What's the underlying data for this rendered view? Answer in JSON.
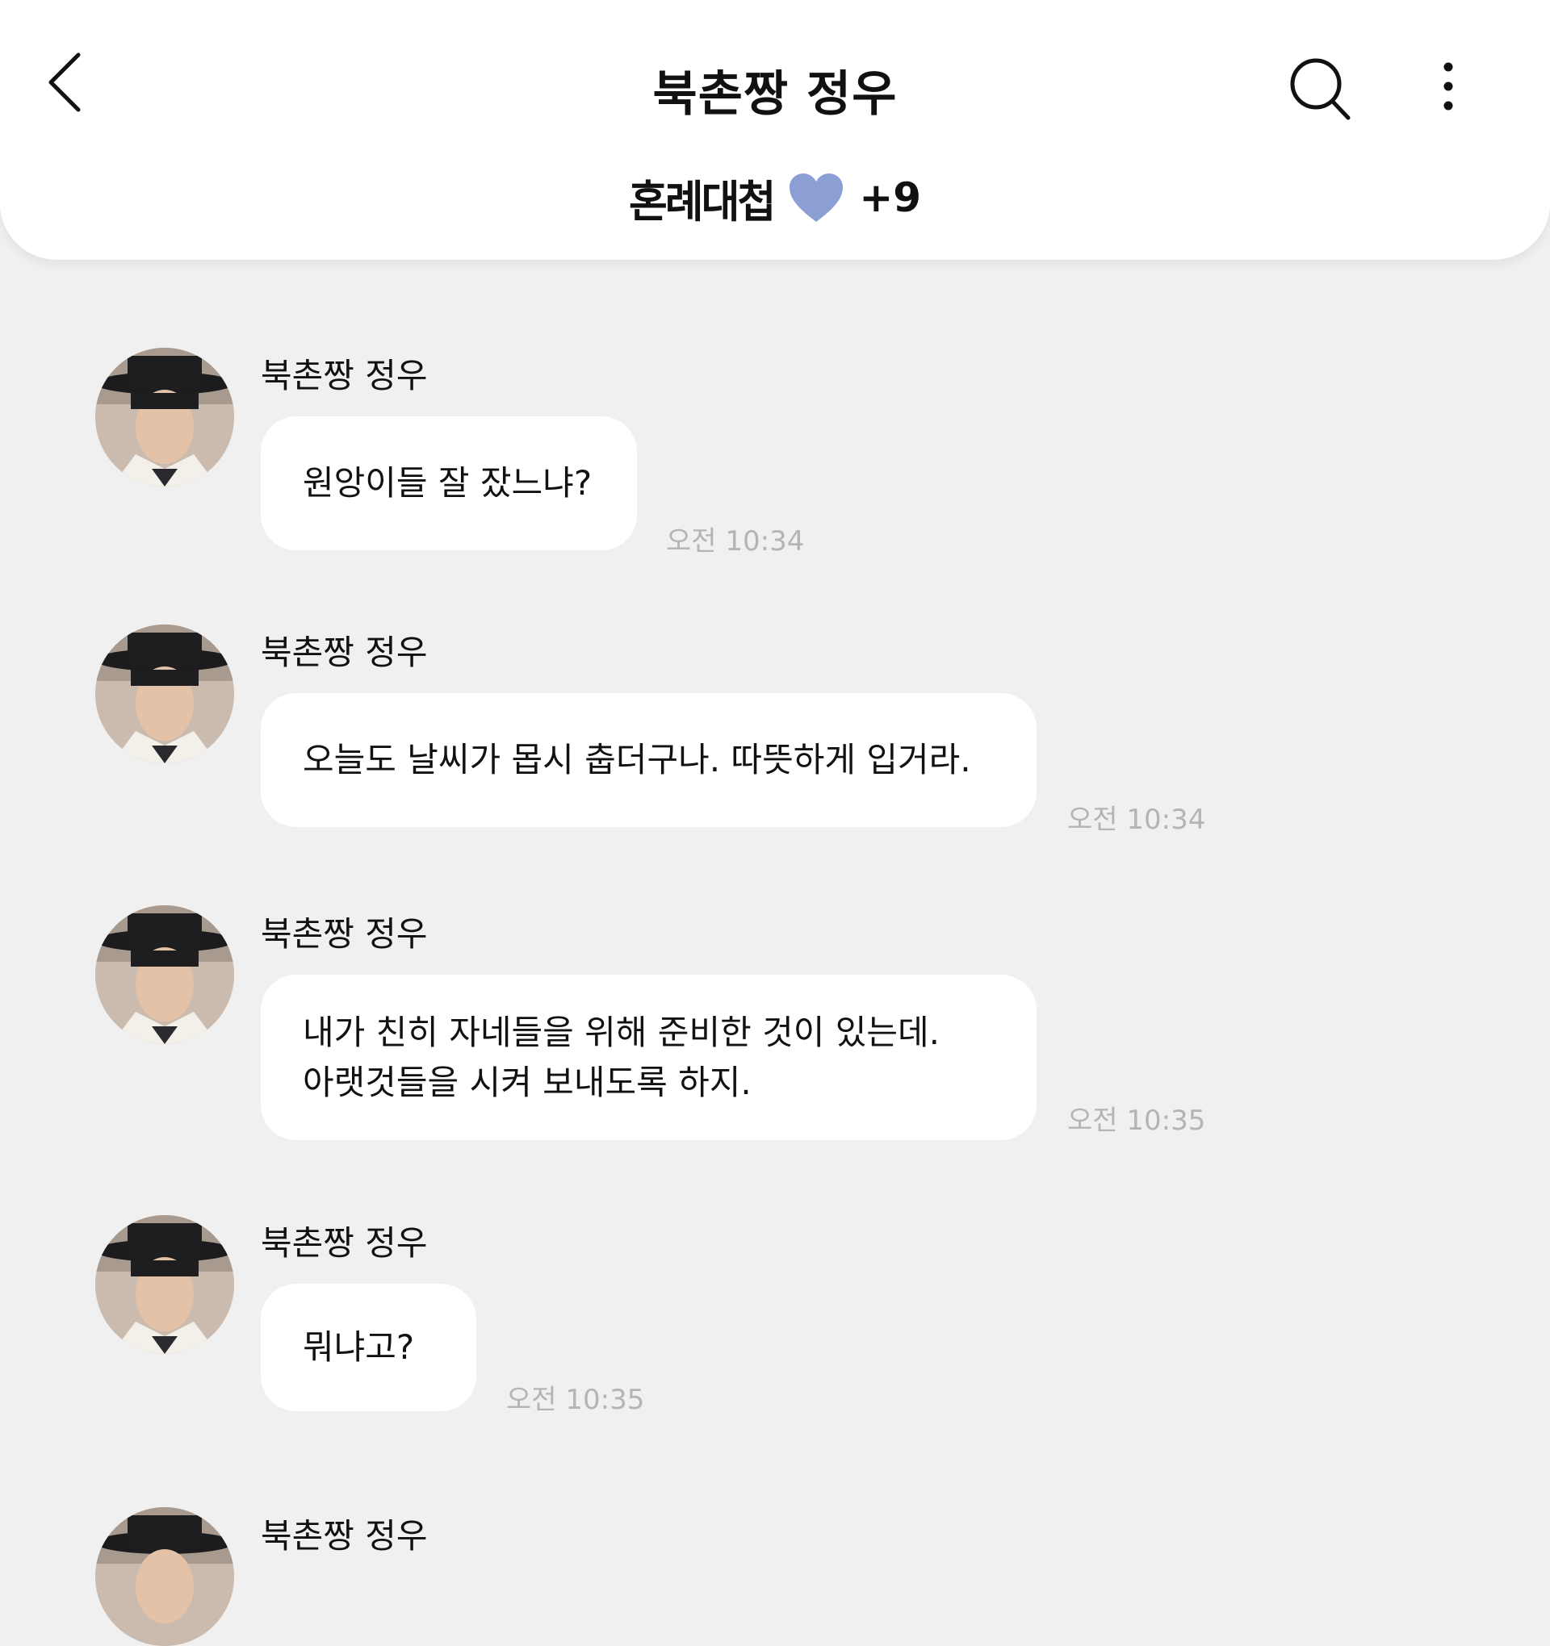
{
  "header": {
    "title": "북촌짱 정우",
    "group_logo_text": "혼례대첩",
    "member_count": "+9",
    "heart_color": "#8c9fd4"
  },
  "icons": {
    "back": "chevron-left-icon",
    "search": "search-icon",
    "more": "more-vertical-icon",
    "heart": "heart-icon"
  },
  "messages": [
    {
      "sender": "북촌짱 정우",
      "lines": [
        "원앙이들 잘 잤느냐?"
      ],
      "time": "오전 10:34"
    },
    {
      "sender": "북촌짱 정우",
      "lines": [
        "오늘도 날씨가 몹시 춥더구나. 따뜻하게 입거라."
      ],
      "time": "오전 10:34"
    },
    {
      "sender": "북촌짱 정우",
      "lines": [
        "내가 친히 자네들을 위해 준비한 것이 있는데.",
        "아랫것들을 시켜 보내도록 하지."
      ],
      "time": "오전 10:35"
    },
    {
      "sender": "북촌짱 정우",
      "lines": [
        "뭐냐고?"
      ],
      "time": "오전 10:35"
    },
    {
      "sender": "북촌짱 정우",
      "lines": [],
      "time": ""
    }
  ]
}
